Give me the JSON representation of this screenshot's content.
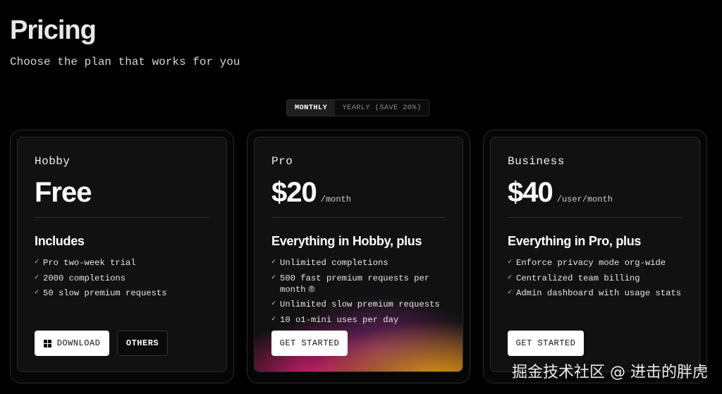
{
  "header": {
    "title": "Pricing",
    "subtitle": "Choose the plan that works for you"
  },
  "billing_toggle": {
    "monthly_label": "MONTHLY",
    "yearly_label": "YEARLY (SAVE 20%)",
    "selected": "MONTHLY"
  },
  "plans": [
    {
      "name": "Hobby",
      "price": "Free",
      "period": "",
      "includes_label": "Includes",
      "features": [
        "Pro two-week trial",
        "2000 completions",
        "50 slow premium requests"
      ],
      "buttons": [
        {
          "label": "DOWNLOAD",
          "icon": "windows-icon"
        },
        {
          "label": "OTHERS"
        }
      ]
    },
    {
      "name": "Pro",
      "price": "$20",
      "period": "/month",
      "includes_label": "Everything in Hobby, plus",
      "features": [
        "Unlimited completions",
        "500 fast premium requests per month",
        "Unlimited slow premium requests",
        "10 o1-mini uses per day"
      ],
      "help_icon_glyph": "?",
      "buttons": [
        {
          "label": "GET STARTED"
        }
      ]
    },
    {
      "name": "Business",
      "price": "$40",
      "period": "/user/month",
      "includes_label": "Everything in Pro, plus",
      "features": [
        "Enforce privacy mode org-wide",
        "Centralized team billing",
        "Admin dashboard with usage stats"
      ],
      "buttons": [
        {
          "label": "GET STARTED"
        }
      ]
    }
  ],
  "check_glyph": "✓",
  "watermark": "掘金技术社区 @ 进击的胖虎",
  "colors": {
    "background": "#000000",
    "card": "#111111",
    "pro_gradient_pink": "#d21e6e",
    "pro_gradient_orange": "#f0a014"
  }
}
